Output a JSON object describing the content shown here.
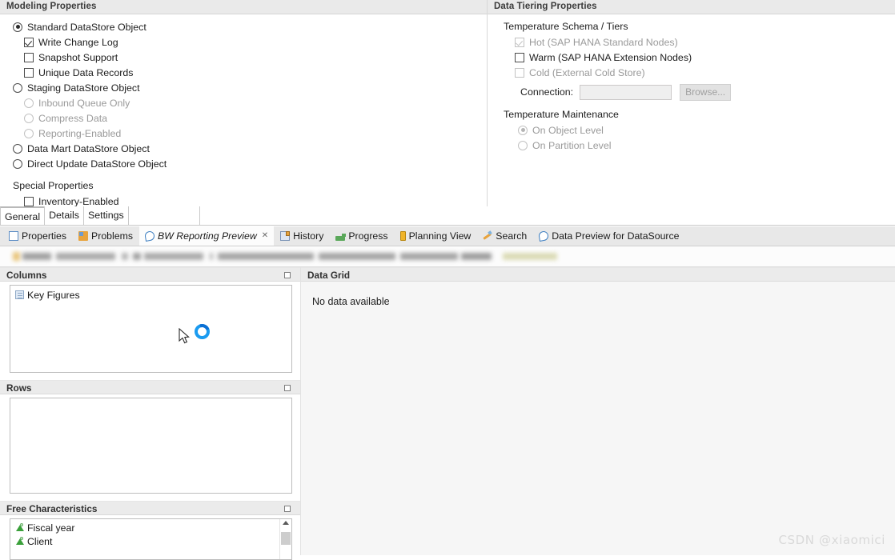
{
  "modeling": {
    "header": "Modeling Properties",
    "options": [
      {
        "type": "radio",
        "checked": true,
        "disabled": false,
        "indent": 0,
        "label": "Standard DataStore Object"
      },
      {
        "type": "check",
        "checked": true,
        "disabled": false,
        "indent": 1,
        "label": "Write Change Log"
      },
      {
        "type": "check",
        "checked": false,
        "disabled": false,
        "indent": 1,
        "label": "Snapshot Support"
      },
      {
        "type": "check",
        "checked": false,
        "disabled": false,
        "indent": 1,
        "label": "Unique Data Records"
      },
      {
        "type": "radio",
        "checked": false,
        "disabled": false,
        "indent": 0,
        "label": "Staging DataStore Object"
      },
      {
        "type": "radio",
        "checked": false,
        "disabled": true,
        "indent": 1,
        "label": "Inbound Queue Only"
      },
      {
        "type": "radio",
        "checked": false,
        "disabled": true,
        "indent": 1,
        "label": "Compress Data"
      },
      {
        "type": "radio",
        "checked": false,
        "disabled": true,
        "indent": 1,
        "label": "Reporting-Enabled"
      },
      {
        "type": "radio",
        "checked": false,
        "disabled": false,
        "indent": 0,
        "label": "Data Mart DataStore Object"
      },
      {
        "type": "radio",
        "checked": false,
        "disabled": false,
        "indent": 0,
        "label": "Direct Update DataStore Object"
      }
    ],
    "special_properties_title": "Special Properties",
    "special_options": [
      {
        "type": "check",
        "checked": false,
        "disabled": false,
        "indent": 1,
        "label": "Inventory-Enabled"
      }
    ]
  },
  "tiering": {
    "header": "Data Tiering Properties",
    "schema_title": "Temperature Schema / Tiers",
    "tiers": [
      {
        "type": "check",
        "checked": true,
        "disabled": true,
        "indent": 1,
        "label": "Hot (SAP HANA Standard Nodes)"
      },
      {
        "type": "check",
        "checked": false,
        "disabled": false,
        "indent": 1,
        "label": "Warm (SAP HANA Extension Nodes)"
      },
      {
        "type": "check",
        "checked": false,
        "disabled": true,
        "indent": 1,
        "label": "Cold (External Cold Store)"
      }
    ],
    "connection_label": "Connection:",
    "connection_value": "",
    "connection_placeholder": "",
    "browse_label": "Browse...",
    "maintenance_title": "Temperature Maintenance",
    "maintenance": [
      {
        "type": "radio",
        "checked": true,
        "disabled": true,
        "indent": 1,
        "label": "On Object Level"
      },
      {
        "type": "radio",
        "checked": false,
        "disabled": true,
        "indent": 1,
        "label": "On Partition Level"
      }
    ]
  },
  "form_tabs": [
    {
      "label": "General",
      "active": true
    },
    {
      "label": "Details",
      "active": false
    },
    {
      "label": "Settings",
      "active": false
    }
  ],
  "view_tabs": [
    {
      "label": "Properties",
      "icon": "properties-icon",
      "active": false,
      "closable": false
    },
    {
      "label": "Problems",
      "icon": "problems-icon",
      "active": false,
      "closable": false
    },
    {
      "label": "BW Reporting Preview",
      "icon": "preview-icon",
      "active": true,
      "closable": true
    },
    {
      "label": "History",
      "icon": "history-icon",
      "active": false,
      "closable": false
    },
    {
      "label": "Progress",
      "icon": "progress-icon",
      "active": false,
      "closable": false
    },
    {
      "label": "Planning View",
      "icon": "planning-icon",
      "active": false,
      "closable": false
    },
    {
      "label": "Search",
      "icon": "search-icon",
      "active": false,
      "closable": false
    },
    {
      "label": "Data Preview for DataSource",
      "icon": "preview-icon",
      "active": false,
      "closable": false
    }
  ],
  "breadcrumb": {
    "note": "redacted-blurred-path"
  },
  "panels": {
    "columns": {
      "title": "Columns",
      "items": [
        {
          "icon": "key-figures-icon",
          "label": "Key Figures"
        }
      ]
    },
    "rows": {
      "title": "Rows",
      "items": []
    },
    "free_characteristics": {
      "title": "Free Characteristics",
      "items": [
        {
          "icon": "characteristic-icon",
          "label": "Fiscal year"
        },
        {
          "icon": "characteristic-icon",
          "label": "Client"
        }
      ]
    },
    "data_grid": {
      "title": "Data Grid",
      "empty_message": "No data available"
    }
  },
  "watermark": "CSDN @xiaomici",
  "colors": {
    "accent_spinner": "#1a9bf0",
    "header_bg": "#eaeaea",
    "panel_header_bg": "#ebebeb",
    "tabbar_bg": "#e8e8e8"
  }
}
